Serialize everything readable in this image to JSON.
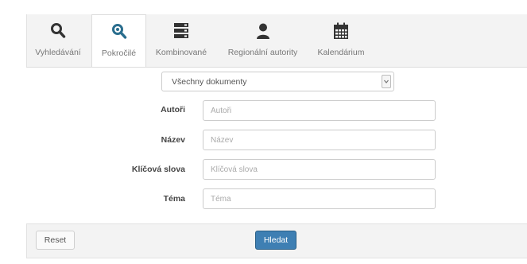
{
  "tabs": [
    {
      "label": "Vyhledávání",
      "icon": "search-icon"
    },
    {
      "label": "Pokročilé",
      "icon": "zoom-search-icon"
    },
    {
      "label": "Kombinované",
      "icon": "server-stack-icon"
    },
    {
      "label": "Regionální autority",
      "icon": "user-icon"
    },
    {
      "label": "Kalendárium",
      "icon": "calendar-icon"
    }
  ],
  "active_tab": 1,
  "doc_type_select": {
    "value": "Všechny dokumenty"
  },
  "fields": [
    {
      "label": "Autoři",
      "placeholder": "Autoři"
    },
    {
      "label": "Název",
      "placeholder": "Název"
    },
    {
      "label": "Klíčová slova",
      "placeholder": "Klíčová slova"
    },
    {
      "label": "Téma",
      "placeholder": "Téma"
    }
  ],
  "buttons": {
    "reset": "Reset",
    "search": "Hledat"
  },
  "colors": {
    "accent": "#3e7fb3",
    "icon": "#333333",
    "active_icon": "#2a6e8e"
  }
}
